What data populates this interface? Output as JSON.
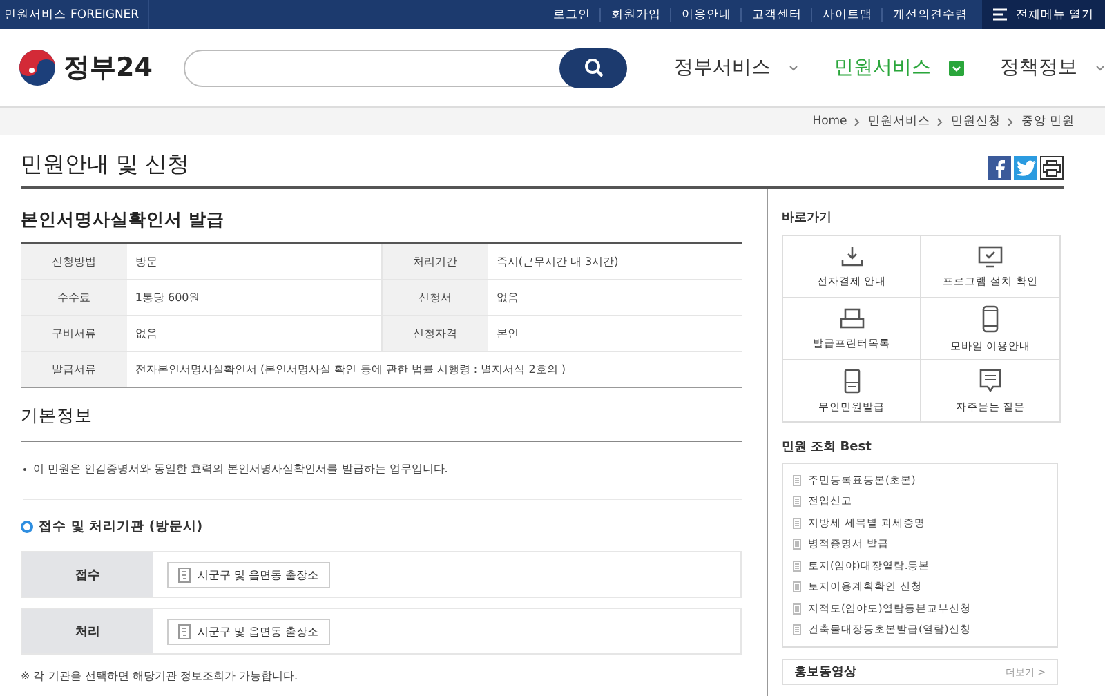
{
  "topbar": {
    "site_links": [
      "민원서비스",
      "FOREIGNER"
    ],
    "links": [
      "로그인",
      "회원가입",
      "이용안내",
      "고객센터",
      "사이트맵",
      "개선의견수렴"
    ],
    "menu_button": "전체메뉴 열기"
  },
  "header": {
    "logo": "정부24",
    "nav": [
      {
        "label": "정부서비스",
        "selected": false
      },
      {
        "label": "민원서비스",
        "selected": true
      },
      {
        "label": "정책정보",
        "selected": false
      }
    ]
  },
  "breadcrumb": [
    "Home",
    "민원서비스",
    "민원신청",
    "중앙 민원"
  ],
  "page_title": "민원안내 및 신청",
  "service": {
    "title": "본인서명사실확인서 발급",
    "rows": [
      [
        {
          "label": "신청방법",
          "value": "방문"
        },
        {
          "label": "처리기간",
          "value": "즉시(근무시간 내 3시간)"
        }
      ],
      [
        {
          "label": "수수료",
          "value": "1통당 600원"
        },
        {
          "label": "신청서",
          "value": "없음"
        }
      ],
      [
        {
          "label": "구비서류",
          "value": "없음"
        },
        {
          "label": "신청자격",
          "value": "본인"
        }
      ],
      [
        {
          "label": "발급서류",
          "value": "전자본인서명사실확인서 (본인서명사실 확인 등에 관한 법률 시행령 : 별지서식 2호의 )"
        }
      ]
    ]
  },
  "basic_info": {
    "heading": "기본정보",
    "bullet": "이 민원은 인감증명서와 동일한 효력의 본인서명사실확인서를 발급하는 업무입니다.",
    "agency_heading": "접수 및 처리기관 (방문시)",
    "agencies": [
      {
        "label": "접수",
        "value": "시군구 및 읍면동 출장소"
      },
      {
        "label": "처리",
        "value": "시군구 및 읍면동 출장소"
      }
    ],
    "note": "※ 각 기관을 선택하면 해당기관 정보조회가 가능합니다."
  },
  "sidebar": {
    "shortcuts": {
      "heading": "바로가기",
      "items": [
        "전자결제 안내",
        "프로그램 설치 확인",
        "발급프린터목록",
        "모바일 이용안내",
        "무인민원발급",
        "자주묻는 질문"
      ]
    },
    "best": {
      "heading": "민원 조회 Best",
      "items": [
        "주민등록표등본(초본)",
        "전입신고",
        "지방세 세목별 과세증명",
        "병적증명서 발급",
        "토지(임야)대장열람.등본",
        "토지이용계획확인 신청",
        "지적도(임야도)열람등본교부신청",
        "건축물대장등초본발급(열람)신청"
      ]
    },
    "promo": {
      "heading": "홍보동영상",
      "more": "더보기 >"
    }
  }
}
